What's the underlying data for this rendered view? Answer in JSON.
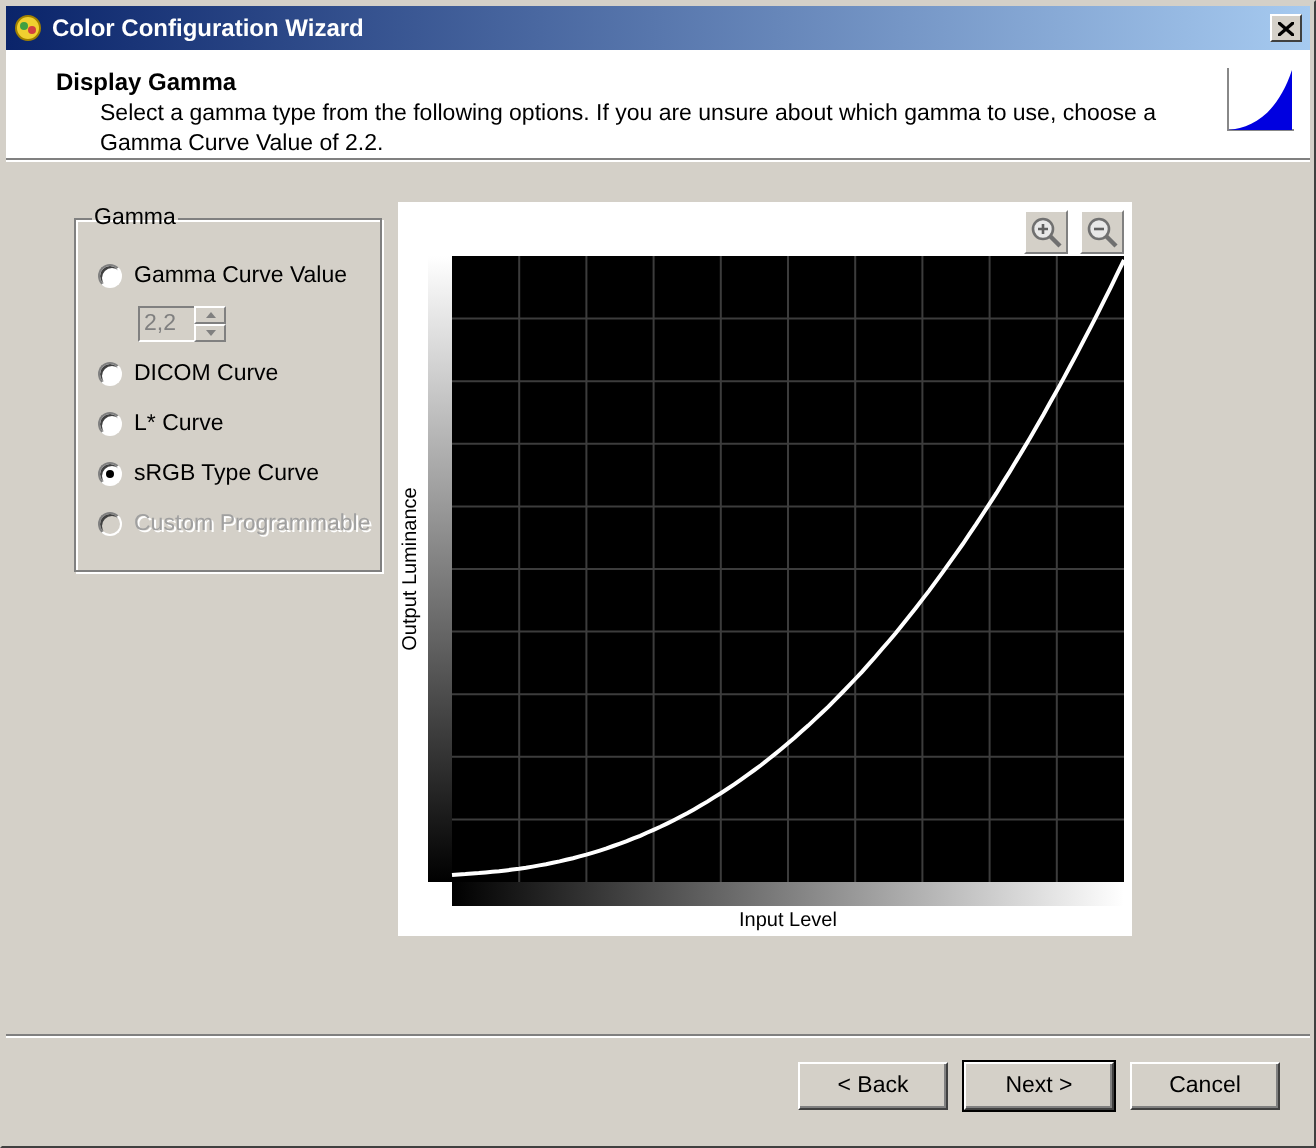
{
  "window": {
    "title": "Color Configuration Wizard"
  },
  "header": {
    "title": "Display Gamma",
    "description": "Select a gamma type from the following options. If you are unsure about which gamma to use, choose a Gamma Curve Value of 2.2."
  },
  "gamma_group": {
    "label": "Gamma",
    "options": [
      {
        "label": "Gamma Curve Value",
        "selected": false,
        "disabled": false,
        "spin": {
          "value": "2,2",
          "disabled": true
        }
      },
      {
        "label": "DICOM Curve",
        "selected": false,
        "disabled": false
      },
      {
        "label": "L* Curve",
        "selected": false,
        "disabled": false
      },
      {
        "label": "sRGB Type Curve",
        "selected": true,
        "disabled": false
      },
      {
        "label": "Custom Programmable",
        "selected": false,
        "disabled": true
      }
    ]
  },
  "chart": {
    "ylabel": "Output Luminance",
    "xlabel": "Input Level"
  },
  "buttons": [
    {
      "label": "< Back",
      "default": false
    },
    {
      "label": "Next >",
      "default": true
    },
    {
      "label": "Cancel",
      "default": false
    }
  ]
}
